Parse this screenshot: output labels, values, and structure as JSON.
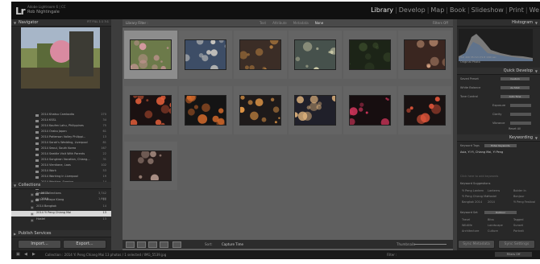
{
  "app": {
    "logo": "Lr",
    "identity_line1": "Adobe Lightroom 6 | CC",
    "identity_line2": "Rob Nightingale"
  },
  "modules": [
    "Library",
    "Develop",
    "Map",
    "Book",
    "Slideshow",
    "Print",
    "We"
  ],
  "active_module": "Library",
  "navigator": {
    "title": "Navigator",
    "options": "FIT  FILL  1:1  3:1"
  },
  "folders": [
    {
      "name": "2014 Khatsu Cambodia",
      "count": "270"
    },
    {
      "name": "2014 KSSL",
      "count": "34"
    },
    {
      "name": "2014 Koufen Lahu, Philippines",
      "count": "75"
    },
    {
      "name": "2014 Orabu Japan",
      "count": "61"
    },
    {
      "name": "2014 Patterson Valley Philippi...",
      "count": "13"
    },
    {
      "name": "2014 Sarah's Wedding, Liverpool",
      "count": "81"
    },
    {
      "name": "2014 Seoul, South Korea",
      "count": "167"
    },
    {
      "name": "2014 Seattle Visit With Parents",
      "count": "22"
    },
    {
      "name": "2014 Songkran Vacation, Chiang...",
      "count": "31"
    },
    {
      "name": "2014 Vientiane, Laos",
      "count": "102"
    },
    {
      "name": "2014 Work",
      "count": "53"
    },
    {
      "name": "2014 Working in Liverpool",
      "count": "19"
    },
    {
      "name": "2014 Working, Soaring",
      "count": "14"
    },
    {
      "name": "2014 Yorkshire",
      "count": "125"
    },
    {
      "name": "2015",
      "count": "3,742"
    },
    {
      "name": "2016",
      "count": "1,660"
    }
  ],
  "collections": {
    "title": "Collections",
    "items": [
      {
        "name": "Smart Collections",
        "count": ""
      },
      {
        "name": "2014 Pattaya Kiang",
        "count": "11"
      },
      {
        "name": "2014 Bangkok",
        "count": "14"
      },
      {
        "name": "2014 Yi Peng Chiang Mai",
        "count": "13"
      },
      {
        "name": "Hostel",
        "count": "13"
      }
    ],
    "selected_index": 3
  },
  "publish_services": "Publish Services",
  "buttons": {
    "import": "Import...",
    "export": "Export..."
  },
  "library_filter": {
    "label": "Library Filter :",
    "tabs": [
      "Text",
      "Attribute",
      "Metadata",
      "None"
    ],
    "active_tab": "None",
    "right": "Filters Off"
  },
  "grid": {
    "sort_label": "Sort:",
    "sort_value": "Capture Time",
    "thumbnails_label": "Thumbnails"
  },
  "right_panel": {
    "histogram_title": "Histogram",
    "histogram_readout": "ISO 400   35 mm   f/1.8   1/60 sec",
    "original_photo": "Original Photo",
    "quick_develop_title": "Quick Develop",
    "quick_develop": [
      {
        "label": "Saved Preset",
        "value": "Custom"
      },
      {
        "label": "White Balance",
        "value": "As Shot"
      },
      {
        "label": "Tone Control",
        "value": "Auto Tone"
      },
      {
        "label": "Exposure",
        "value": ""
      },
      {
        "label": "Clarity",
        "value": ""
      },
      {
        "label": "Vibrance",
        "value": ""
      }
    ],
    "reset_all": "Reset All",
    "keywording_title": "Keywording",
    "keyword_tags_label": "Keyword Tags",
    "keyword_tags_mode": "Enter Keywords",
    "keywords_text": "Asia, Yi Yi, Chiang Mai, Yi Peng",
    "click_to_add": "Click here to add keywords",
    "keyword_suggestions_label": "Keyword Suggestions",
    "suggestions": [
      "Yi Peng Lantern",
      "Lanterns",
      "Bolder In",
      "Yi Peng Chiang Mai",
      "Hostel",
      "Bonjour",
      "Bangkok 2014",
      "2014",
      "Yi Peng Festival"
    ],
    "keyword_set_label": "Keyword Set",
    "keyword_set_value": "Outdoor",
    "keyword_set": [
      "Travel",
      "Bliss",
      "Tagged",
      "Wildlife",
      "Landscape",
      "Sunset",
      "Architecture",
      "Culture",
      "Portrait"
    ],
    "sync_metadata": "Sync Metadata",
    "sync_settings": "Sync Settings"
  },
  "filmstrip": {
    "path": "Collection : 2014 Yi Peng Chiang Mai      13 photos / 1 selected / IMG_5539.jpg",
    "filter_label": "Filter :",
    "filter_value": "Filters Off"
  },
  "photos": [
    {
      "alt": "tuk-tuk street scene",
      "bg": "#6c7a4a",
      "accent": "#d99aa5"
    },
    {
      "alt": "crowd with lanterns",
      "bg": "#3d4d66",
      "accent": "#d7d2c9"
    },
    {
      "alt": "night market crowd",
      "bg": "#3b2d26",
      "accent": "#c88a42"
    },
    {
      "alt": "stadium crowd",
      "bg": "#46514c",
      "accent": "#dad7b2"
    },
    {
      "alt": "dark night scene",
      "bg": "#1c2417",
      "accent": "#3a4a2b"
    },
    {
      "alt": "group portrait",
      "bg": "#3a2620",
      "accent": "#d3a07f"
    },
    {
      "alt": "lanterns in sky",
      "bg": "#1b1111",
      "accent": "#e25e3a"
    },
    {
      "alt": "night lanterns",
      "bg": "#141414",
      "accent": "#d46a2b"
    },
    {
      "alt": "lantern release",
      "bg": "#1e1a1a",
      "accent": "#f0a04a"
    },
    {
      "alt": "glowing lantern",
      "bg": "#20202a",
      "accent": "#f3c285"
    },
    {
      "alt": "red lights",
      "bg": "#170e10",
      "accent": "#d0355b"
    },
    {
      "alt": "lantern field",
      "bg": "#191212",
      "accent": "#e0553a"
    },
    {
      "alt": "portrait with lantern",
      "bg": "#2a1e1c",
      "accent": "#e5c3b4"
    }
  ],
  "selected_photo_index": 0
}
